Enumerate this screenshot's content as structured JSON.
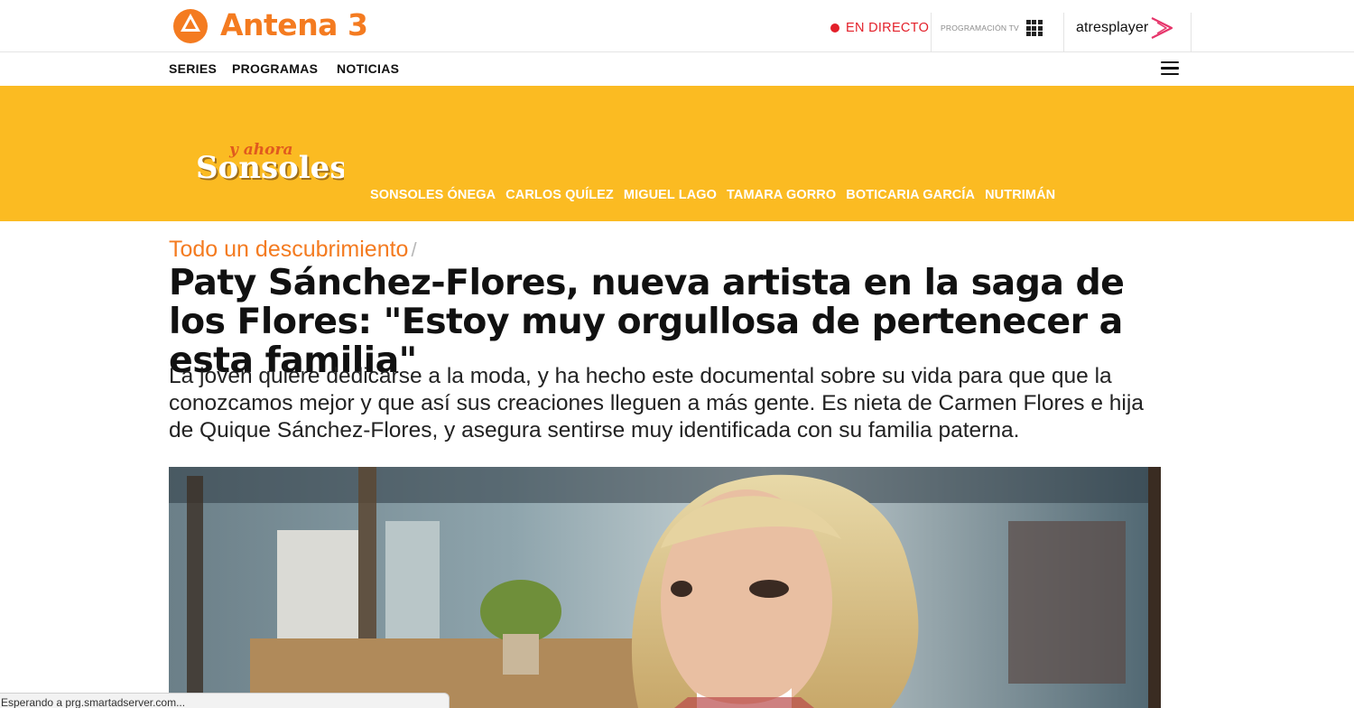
{
  "header": {
    "brand": "Antena 3",
    "live_label": "EN DIRECTO",
    "programacion_label": "PROGRAMACIÓN TV",
    "atresplayer_label": "atresplayer"
  },
  "nav": {
    "items": [
      "SERIES",
      "PROGRAMAS",
      "NOTICIAS"
    ]
  },
  "show": {
    "logo_small": "y ahora",
    "logo_main": "Sonsoles",
    "links": [
      "SONSOLES ÓNEGA",
      "CARLOS QUÍLEZ",
      "MIGUEL LAGO",
      "TAMARA GORRO",
      "BOTICARIA GARCÍA",
      "NUTRIMÁN"
    ]
  },
  "article": {
    "kicker": "Todo un descubrimiento",
    "kicker_separator": "/",
    "headline": "Paty Sánchez-Flores, nueva artista en la saga de los Flores: \"Estoy muy orgullosa de pertenecer a esta familia\"",
    "lead": "La joven quiere dedicarse a la moda, y ha hecho este documental sobre su vida para que que la conozcamos mejor y que así sus creaciones lleguen a más gente. Es nieta de Carmen Flores e hija de Quique Sánchez-Flores, y asegura sentirse muy identificada con su familia paterna."
  },
  "status_bar": {
    "text": "Esperando a prg.smartadserver.com..."
  },
  "colors": {
    "brand_orange": "#f47b20",
    "banner_yellow": "#fbbb22",
    "live_red": "#e3202a",
    "atresplayer_pink": "#e6346a"
  }
}
